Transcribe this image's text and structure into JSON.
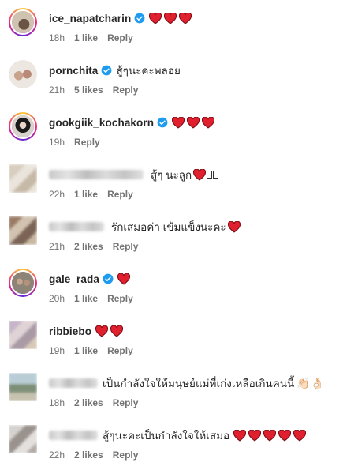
{
  "comments": [
    {
      "username": "ice_napatcharin",
      "verified": true,
      "text": "",
      "hearts": 3,
      "time": "18h",
      "likes": "1 like",
      "reply": "Reply"
    },
    {
      "username": "pornchita",
      "verified": true,
      "text": "สู้ๆนะคะพลอย",
      "hearts": 0,
      "time": "21h",
      "likes": "5 likes",
      "reply": "Reply"
    },
    {
      "username": "gookgiik_kochakorn",
      "verified": true,
      "text": "",
      "hearts": 3,
      "time": "19h",
      "likes": "",
      "reply": "Reply"
    },
    {
      "username": "",
      "verified": false,
      "text": "สู้ๆ นะลูก",
      "hearts": 1,
      "time": "22h",
      "likes": "1 like",
      "reply": "Reply"
    },
    {
      "username": "",
      "verified": false,
      "text": "รักเสมอค่า เข้มแข็งนะคะ",
      "hearts": 1,
      "time": "21h",
      "likes": "2 likes",
      "reply": "Reply"
    },
    {
      "username": "gale_rada",
      "verified": true,
      "text": "",
      "hearts": 1,
      "time": "20h",
      "likes": "1 like",
      "reply": "Reply"
    },
    {
      "username": "ribbiebo",
      "verified": false,
      "text": "",
      "hearts": 2,
      "time": "19h",
      "likes": "1 like",
      "reply": "Reply"
    },
    {
      "username": "",
      "verified": false,
      "text": "เป็นกำลังใจให้มนุษย์แม่ที่เก่งเหลือเกินคนนี้",
      "hearts": 0,
      "emoji": "👏🏻👌🏻",
      "time": "18h",
      "likes": "2 likes",
      "reply": "Reply"
    },
    {
      "username": "",
      "verified": false,
      "text": "สู้ๆนะคะเป็นกำลังใจให้เสมอ",
      "hearts": 5,
      "time": "22h",
      "likes": "2 likes",
      "reply": "Reply"
    }
  ],
  "colors": {
    "heart": "#e0202e",
    "verified": "#1d9bf0",
    "meta": "#737373"
  }
}
